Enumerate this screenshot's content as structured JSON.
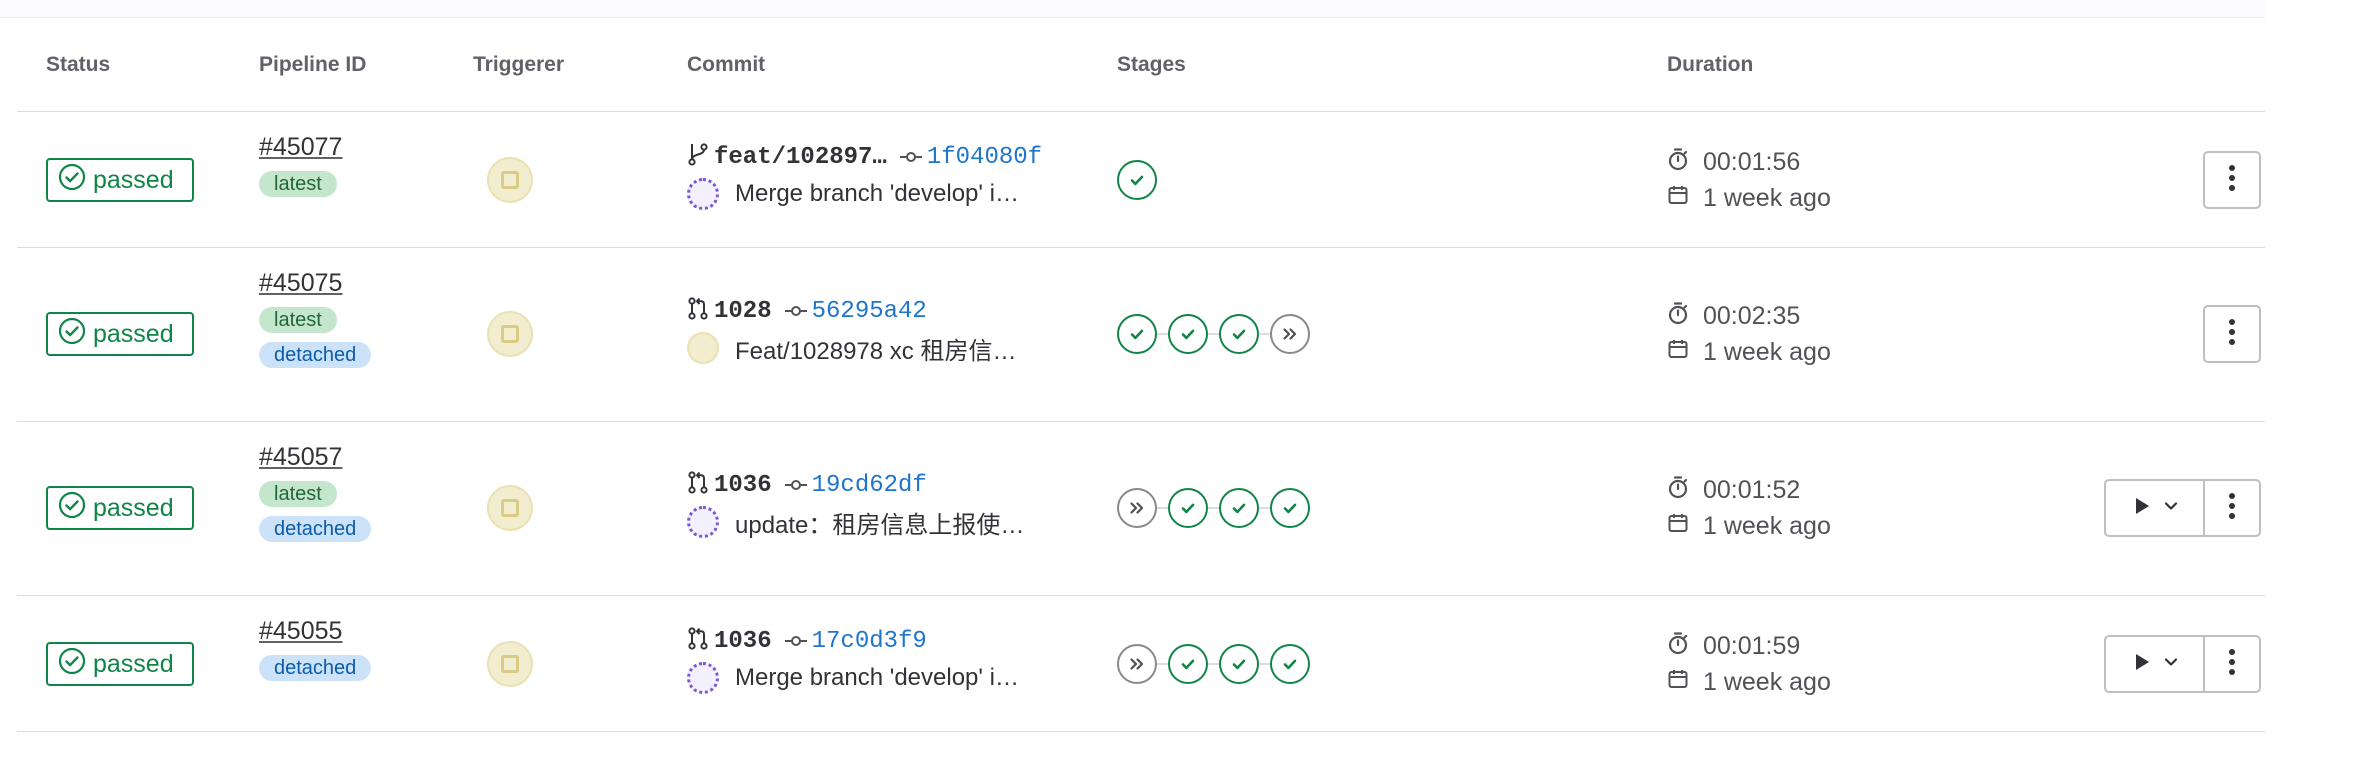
{
  "columns": {
    "status": "Status",
    "pipeline_id": "Pipeline ID",
    "triggerer": "Triggerer",
    "commit": "Commit",
    "stages": "Stages",
    "duration": "Duration"
  },
  "colors": {
    "passed": "#108548",
    "link": "#1f75cb",
    "latest_bg": "#c3e6cd",
    "detached_bg": "#cbe2f9"
  },
  "pipelines": [
    {
      "status": "passed",
      "id": "#45077",
      "badges": [
        "latest"
      ],
      "ref_icon": "branch-icon",
      "ref": "feat/102897…",
      "sha": "1f04080f",
      "author_avatar": "purple",
      "message": "Merge branch 'develop' i…",
      "stages": [
        "success"
      ],
      "duration": "00:01:56",
      "finished": "1 week ago",
      "has_play": false
    },
    {
      "status": "passed",
      "id": "#45075",
      "badges": [
        "latest",
        "detached"
      ],
      "ref_icon": "merge-request-icon",
      "ref": "1028",
      "sha": "56295a42",
      "author_avatar": "yellow",
      "message": "Feat/1028978 xc 租房信…",
      "stages": [
        "success",
        "success",
        "success",
        "skipped"
      ],
      "duration": "00:02:35",
      "finished": "1 week ago",
      "has_play": false
    },
    {
      "status": "passed",
      "id": "#45057",
      "badges": [
        "latest",
        "detached"
      ],
      "ref_icon": "merge-request-icon",
      "ref": "1036",
      "sha": "19cd62df",
      "author_avatar": "purple",
      "message": "update：租房信息上报使…",
      "stages": [
        "skipped",
        "success",
        "success",
        "success"
      ],
      "duration": "00:01:52",
      "finished": "1 week ago",
      "has_play": true
    },
    {
      "status": "passed",
      "id": "#45055",
      "badges": [
        "detached"
      ],
      "ref_icon": "merge-request-icon",
      "ref": "1036",
      "sha": "17c0d3f9",
      "author_avatar": "purple",
      "message": "Merge branch 'develop' i…",
      "stages": [
        "skipped",
        "success",
        "success",
        "success"
      ],
      "duration": "00:01:59",
      "finished": "1 week ago",
      "has_play": true
    }
  ]
}
